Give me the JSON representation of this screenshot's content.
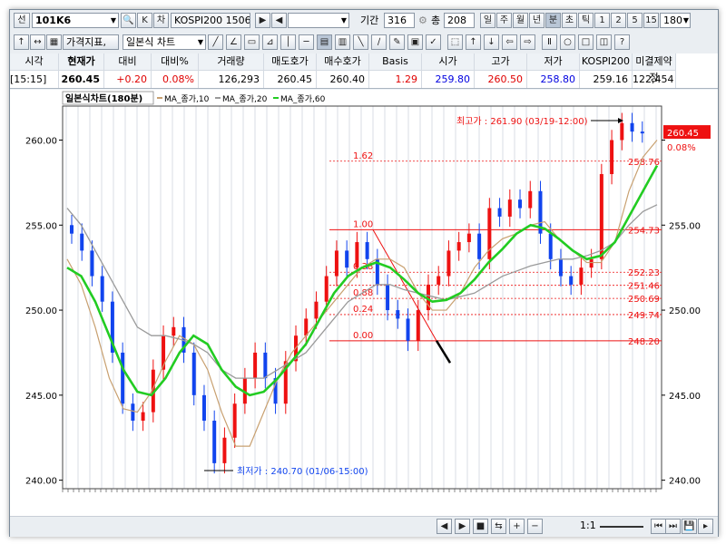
{
  "toolbar1": {
    "code_prefix": "선",
    "code": "101K6",
    "search_btn": "🔍",
    "k_btn": "K",
    "ch_btn": "차",
    "instrument": "KOSPI200 1506",
    "period_label": "기간",
    "period_value": "316",
    "count_label": "총",
    "count_value": "208",
    "period_buttons": [
      "일",
      "주",
      "월",
      "년",
      "분",
      "초",
      "틱",
      "1",
      "2",
      "5",
      "15"
    ],
    "interval_value": "180"
  },
  "toolbar2": {
    "indicator_btn": "가격지표,",
    "chart_type": "일본식 차트"
  },
  "quote_header": {
    "columns": [
      {
        "label": "시각",
        "value": "[15:15]",
        "color": "#000000"
      },
      {
        "label": "현재가",
        "value": "260.45",
        "color": "#000000"
      },
      {
        "label": "대비",
        "value": "+0.20",
        "color": "#e00000"
      },
      {
        "label": "대비%",
        "value": "0.08%",
        "color": "#e00000"
      },
      {
        "label": "거래량",
        "value": "126,293",
        "color": "#000000"
      },
      {
        "label": "매도호가",
        "value": "260.45",
        "color": "#000000"
      },
      {
        "label": "매수호가",
        "value": "260.40",
        "color": "#000000"
      },
      {
        "label": "Basis",
        "value": "1.29",
        "color": "#e00000"
      },
      {
        "label": "시가",
        "value": "259.80",
        "color": "#0000e0"
      },
      {
        "label": "고가",
        "value": "260.50",
        "color": "#e00000"
      },
      {
        "label": "저가",
        "value": "258.80",
        "color": "#0000e0"
      },
      {
        "label": "KOSPI200",
        "value": "259.16",
        "color": "#000000"
      },
      {
        "label": "미결제약정",
        "value": "122,454",
        "color": "#000000"
      }
    ]
  },
  "chart": {
    "title": "일본식차트(180분)",
    "legend": [
      {
        "name": "MA_종가,10",
        "color": "#c8a070"
      },
      {
        "name": "MA_종가,20",
        "color": "#9a9a9a"
      },
      {
        "name": "MA_종가,60",
        "color": "#22cc22"
      }
    ],
    "high_annotation": "최고가 : 261.90 (03/19-12:00)",
    "low_annotation": "최저가 : 240.70 (01/06-15:00)",
    "current_price_label": "260.45",
    "current_change_label": "0.08%",
    "fib_levels": [
      {
        "ratio": "1.62",
        "price": "258.76"
      },
      {
        "ratio": "1.00",
        "price": "254.73"
      },
      {
        "ratio": "0.38",
        "price": "252.23"
      },
      {
        "ratio": "",
        "price": "251.46"
      },
      {
        "ratio": "0.88",
        "price": "250.69"
      },
      {
        "ratio": "0.24",
        "price": "249.74"
      },
      {
        "ratio": "0.00",
        "price": "248.20"
      }
    ],
    "left_axis_ticks": [
      "260.00",
      "255.00",
      "250.00",
      "245.00",
      "240.00"
    ],
    "right_axis_ticks": [
      "255.00",
      "250.00",
      "245.00",
      "240.00"
    ]
  },
  "bottom_bar": {
    "zoom_label": "1:1",
    "controls": [
      "◀",
      "▶",
      "■",
      "⇆",
      "+",
      "−"
    ]
  },
  "chart_data": {
    "type": "candlestick",
    "title": "일본식차트(180분)",
    "ylim": [
      239.5,
      262.0
    ],
    "y_ticks": [
      240,
      245,
      250,
      255,
      260
    ],
    "series": [
      {
        "name": "MA_종가,10",
        "values": [
          253.0,
          251.5,
          249.0,
          246.0,
          244.2,
          244.0,
          245.2,
          247.0,
          248.5,
          248.0,
          246.5,
          244.0,
          242.0,
          242.0,
          244.0,
          246.0,
          247.5,
          248.5,
          249.5,
          250.5,
          251.5,
          252.5,
          253.0,
          253.0,
          252.5,
          251.0,
          250.0,
          250.0,
          251.0,
          252.5,
          253.5,
          254.2,
          254.5,
          255.0,
          255.2,
          254.2,
          253.5,
          252.8,
          252.8,
          254.0,
          257.0,
          259.0,
          260.0
        ]
      },
      {
        "name": "MA_종가,20",
        "values": [
          256.0,
          255.0,
          253.5,
          252.0,
          250.5,
          249.0,
          248.5,
          248.5,
          248.3,
          248.0,
          247.5,
          246.5,
          246.0,
          246.0,
          246.0,
          246.5,
          247.0,
          247.5,
          248.5,
          249.5,
          250.5,
          251.0,
          251.5,
          251.5,
          251.2,
          251.0,
          250.8,
          250.6,
          250.8,
          251.0,
          251.5,
          252.0,
          252.3,
          252.6,
          252.8,
          253.0,
          253.0,
          253.2,
          253.5,
          254.0,
          255.0,
          255.8,
          256.2
        ]
      },
      {
        "name": "MA_종가,60",
        "values": [
          252.5,
          252.0,
          250.5,
          248.5,
          246.5,
          245.2,
          245.0,
          246.0,
          247.5,
          248.5,
          248.0,
          246.5,
          245.5,
          245.0,
          245.2,
          246.0,
          247.0,
          248.0,
          249.5,
          251.0,
          252.0,
          252.5,
          252.8,
          252.5,
          251.8,
          251.0,
          250.5,
          250.6,
          251.0,
          251.8,
          252.8,
          253.6,
          254.5,
          255.0,
          254.8,
          254.2,
          253.5,
          253.0,
          253.2,
          254.0,
          255.5,
          257.0,
          258.5
        ]
      }
    ],
    "candles_close": [
      254.5,
      253.5,
      252.0,
      250.5,
      247.5,
      244.5,
      243.5,
      244.0,
      246.5,
      248.5,
      249.0,
      247.5,
      245.0,
      243.5,
      241.0,
      242.5,
      244.5,
      246.0,
      247.5,
      246.0,
      244.5,
      247.0,
      248.5,
      249.5,
      250.5,
      252.0,
      253.5,
      252.5,
      254.0,
      253.0,
      251.5,
      250.0,
      249.5,
      248.2,
      250.0,
      251.5,
      252.0,
      253.5,
      254.0,
      254.5,
      253.0,
      256.0,
      255.5,
      256.5,
      256.0,
      257.0,
      254.5,
      253.0,
      252.0,
      251.5,
      252.5,
      253.0,
      258.0,
      260.0,
      261.0,
      260.5,
      260.45
    ]
  }
}
